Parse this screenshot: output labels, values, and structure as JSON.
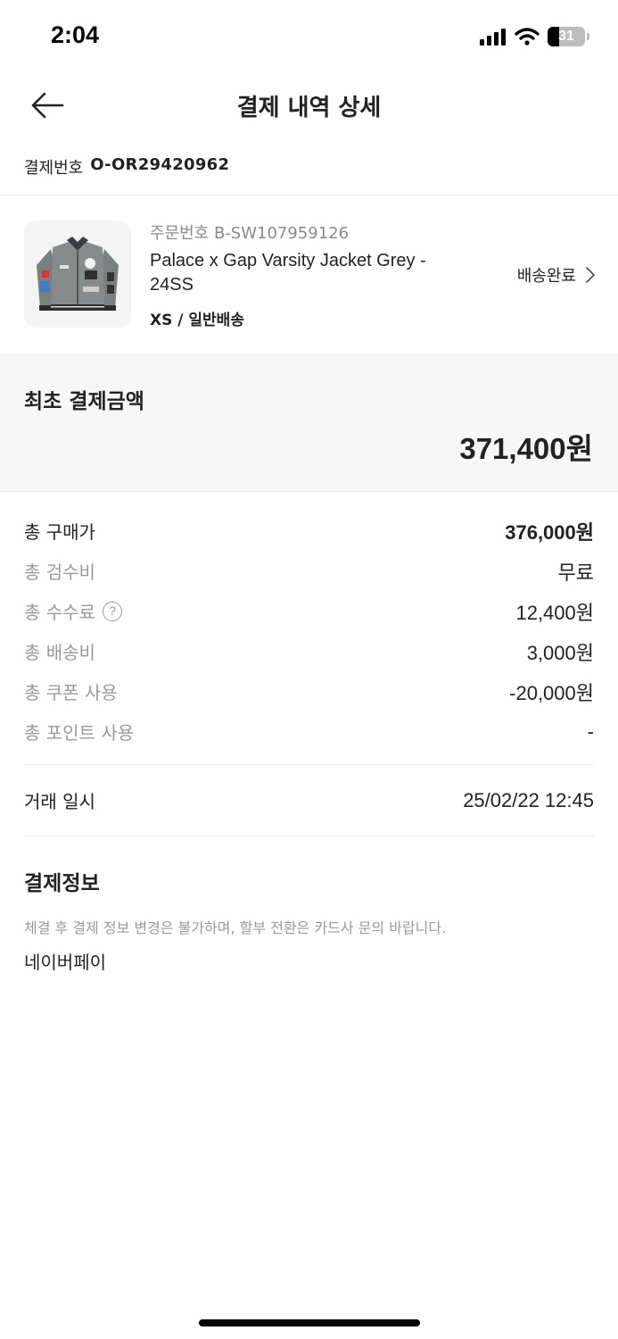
{
  "status_bar": {
    "time": "2:04",
    "battery_level": "31"
  },
  "header": {
    "title": "결제 내역 상세"
  },
  "payment": {
    "number_label": "결제번호",
    "number_value": "O-OR29420962"
  },
  "product": {
    "order_no": "주문번호 B-SW107959126",
    "name": "Palace x Gap Varsity Jacket Grey - 24SS",
    "option": "XS / 일반배송",
    "status": "배송완료"
  },
  "first_payment": {
    "label": "최초 결제금액",
    "amount": "371,400원"
  },
  "breakdown": [
    {
      "label": "총 구매가",
      "value": "376,000원"
    },
    {
      "label": "총 검수비",
      "value": "무료"
    },
    {
      "label": "총 수수료",
      "value": "12,400원"
    },
    {
      "label": "총 배송비",
      "value": "3,000원"
    },
    {
      "label": "총 쿠폰 사용",
      "value": "-20,000원"
    },
    {
      "label": "총 포인트 사용",
      "value": "-"
    }
  ],
  "trade": {
    "label": "거래 일시",
    "value": "25/02/22 12:45"
  },
  "pay_info": {
    "title": "결제정보",
    "notice": "체결 후 결제 정보 변경은 불가하며, 할부 전환은 카드사 문의 바랍니다.",
    "method": "네이버페이"
  },
  "colors": {
    "text_primary": "#222222",
    "text_muted": "#9a9a9a",
    "section_bg": "#f7f7f7",
    "divider": "#ebebeb"
  },
  "icons": [
    "signal-icon",
    "wifi-icon",
    "battery-icon",
    "back-arrow-icon",
    "chevron-right-icon",
    "help-icon"
  ]
}
